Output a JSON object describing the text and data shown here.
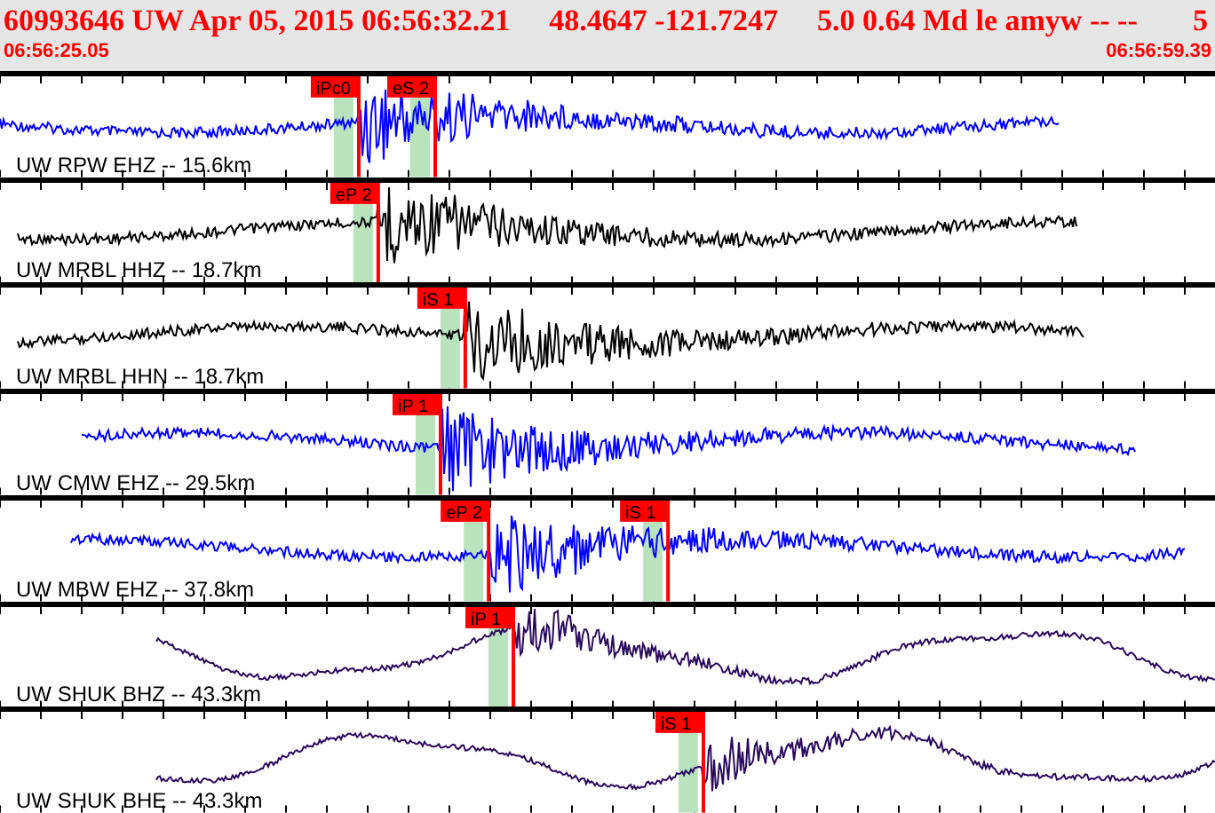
{
  "header": {
    "event": "60993646 UW Apr 05, 2015 06:56:32.21",
    "location": "48.4647 -121.7247",
    "magnitude": "5.0 0.64 Md le amyw -- --",
    "count": "5",
    "start_time": "06:56:25.05",
    "end_time": "06:56:59.39"
  },
  "traces": [
    {
      "label": "UW RPW EHZ -- 15.6km",
      "kind": "short-period",
      "color": "#0000ff",
      "picks": [
        {
          "label": "iPc0"
        },
        {
          "label": "eS 2"
        }
      ]
    },
    {
      "label": "UW MRBL HHZ -- 18.7km",
      "kind": "short-period",
      "color": "#000000",
      "picks": [
        {
          "label": "eP 2"
        }
      ]
    },
    {
      "label": "UW MRBL HHN -- 18.7km",
      "kind": "short-period",
      "color": "#000000",
      "picks": [
        {
          "label": "iS 1"
        }
      ]
    },
    {
      "label": "UW CMW EHZ -- 29.5km",
      "kind": "short-period",
      "color": "#0000ff",
      "picks": [
        {
          "label": "iP 1"
        }
      ]
    },
    {
      "label": "UW MBW EHZ -- 37.8km",
      "kind": "short-period",
      "color": "#0000ff",
      "picks": [
        {
          "label": "eP 2"
        },
        {
          "label": "iS 1"
        }
      ]
    },
    {
      "label": "UW SHUK BHZ -- 43.3km",
      "kind": "broadband",
      "color": "#2a0a5e",
      "picks": [
        {
          "label": "iP 1"
        }
      ]
    },
    {
      "label": "UW SHUK BHE -- 43.3km",
      "kind": "broadband",
      "color": "#2a0a5e",
      "picks": [
        {
          "label": "iS 1"
        }
      ]
    }
  ]
}
